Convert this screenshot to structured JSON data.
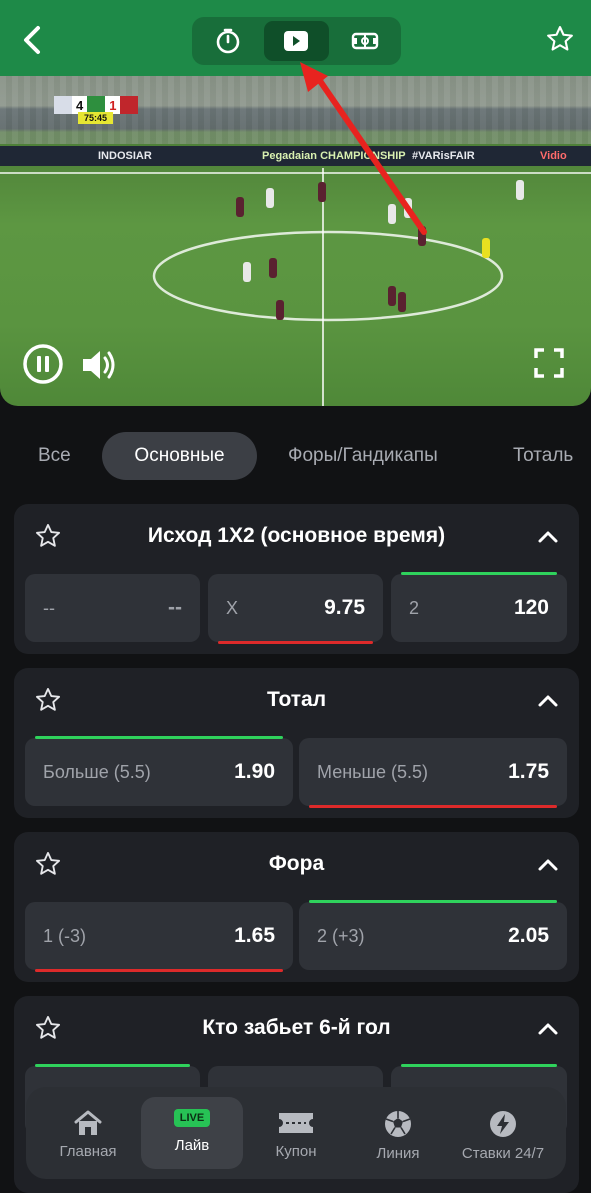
{
  "header": {
    "back_icon": "chevron-left-icon",
    "favorite_icon": "star-icon",
    "view_switch": [
      {
        "icon": "timer-icon",
        "active": false
      },
      {
        "icon": "play-video-icon",
        "active": true
      },
      {
        "icon": "scoreboard-field-icon",
        "active": false
      }
    ]
  },
  "video": {
    "score_home": "4",
    "score_away": "1",
    "match_time": "75:45",
    "ad_texts": [
      "INDOSIAR",
      "Pegadaian CHAMPIONSHIP",
      "#VARisFAIR",
      "Vidio"
    ],
    "pause_icon": "pause-icon",
    "volume_icon": "volume-icon",
    "fullscreen_icon": "fullscreen-icon"
  },
  "tabs": [
    {
      "label": "Все",
      "active": false
    },
    {
      "label": "Основные",
      "active": true
    },
    {
      "label": "Форы/Гандикапы",
      "active": false
    },
    {
      "label": "Тоталь",
      "active": false
    }
  ],
  "markets": [
    {
      "title": "Исход 1X2 (основное время)",
      "odds": [
        {
          "label": "--",
          "value": "--",
          "trend": "none"
        },
        {
          "label": "X",
          "value": "9.75",
          "trend": "down"
        },
        {
          "label": "2",
          "value": "120",
          "trend": "up"
        }
      ]
    },
    {
      "title": "Тотал",
      "odds": [
        {
          "label": "Больше (5.5)",
          "value": "1.90",
          "trend": "up"
        },
        {
          "label": "Меньше (5.5)",
          "value": "1.75",
          "trend": "down"
        }
      ]
    },
    {
      "title": "Фора",
      "odds": [
        {
          "label": "1 (-3)",
          "value": "1.65",
          "trend": "down"
        },
        {
          "label": "2 (+3)",
          "value": "2.05",
          "trend": "up"
        }
      ]
    },
    {
      "title": "Кто забьет 6-й гол",
      "odds": []
    }
  ],
  "bottom_nav": [
    {
      "label": "Главная",
      "icon": "home-icon",
      "active": false
    },
    {
      "label": "Лайв",
      "icon": "live-badge-icon",
      "badge": "LIVE",
      "active": true
    },
    {
      "label": "Купон",
      "icon": "ticket-icon",
      "active": false
    },
    {
      "label": "Линия",
      "icon": "soccer-ball-icon",
      "active": false
    },
    {
      "label": "Ставки 24/7",
      "icon": "lightning-icon",
      "active": false
    }
  ],
  "colors": {
    "header_green": "#1e8a48",
    "trend_up": "#2fd25c",
    "trend_down": "#dd2a2a",
    "annotation_arrow": "#e8231f"
  }
}
